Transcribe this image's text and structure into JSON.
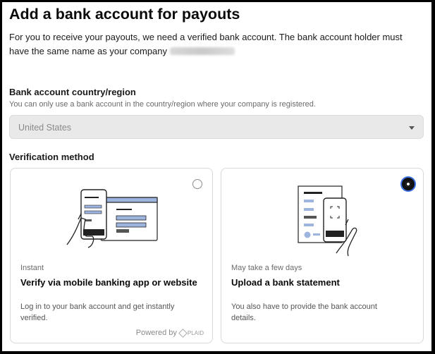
{
  "page": {
    "title": "Add a bank account for payouts",
    "description": "For you to receive your payouts, we need a verified bank account. The bank account holder must have the same name as your company"
  },
  "country": {
    "label": "Bank account country/region",
    "help": "You can only use a bank account in the country/region where your company is registered.",
    "value": "United States"
  },
  "verification": {
    "label": "Verification method",
    "options": [
      {
        "tag": "Instant",
        "title": "Verify via mobile banking app or website",
        "description": "Log in to your bank account and get instantly verified.",
        "powered_by": "Powered by",
        "provider": "PLAID",
        "selected": false
      },
      {
        "tag": "May take a few days",
        "title": "Upload a bank statement",
        "description": "You also have to provide the bank account details.",
        "selected": true
      }
    ]
  },
  "colors": {
    "accent_ring": "#3d6fe0",
    "illustration_blue": "#9db4de"
  }
}
